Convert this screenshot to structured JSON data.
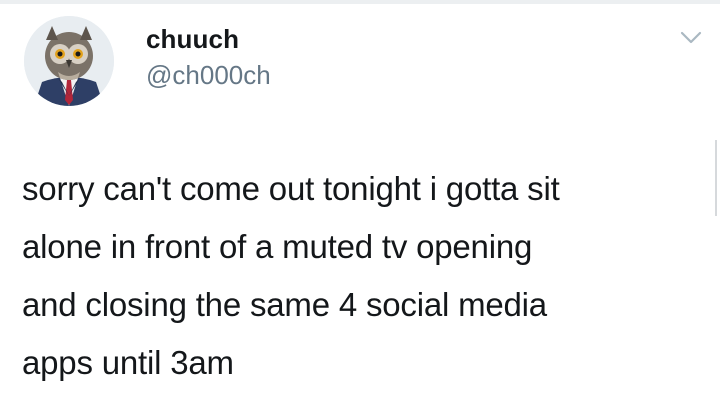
{
  "user": {
    "display_name": "chuuch",
    "handle": "@ch000ch",
    "avatar_icon": "owl-in-suit-avatar"
  },
  "tweet": {
    "lines": [
      "sorry can't come out tonight i gotta sit",
      "alone in front of a muted tv opening",
      "and closing the same 4 social media",
      "apps until 3am"
    ]
  },
  "icons": {
    "menu": "chevron-down-icon"
  },
  "colors": {
    "text": "#14171a",
    "secondary": "#657786",
    "chevron": "#aab8c2"
  }
}
